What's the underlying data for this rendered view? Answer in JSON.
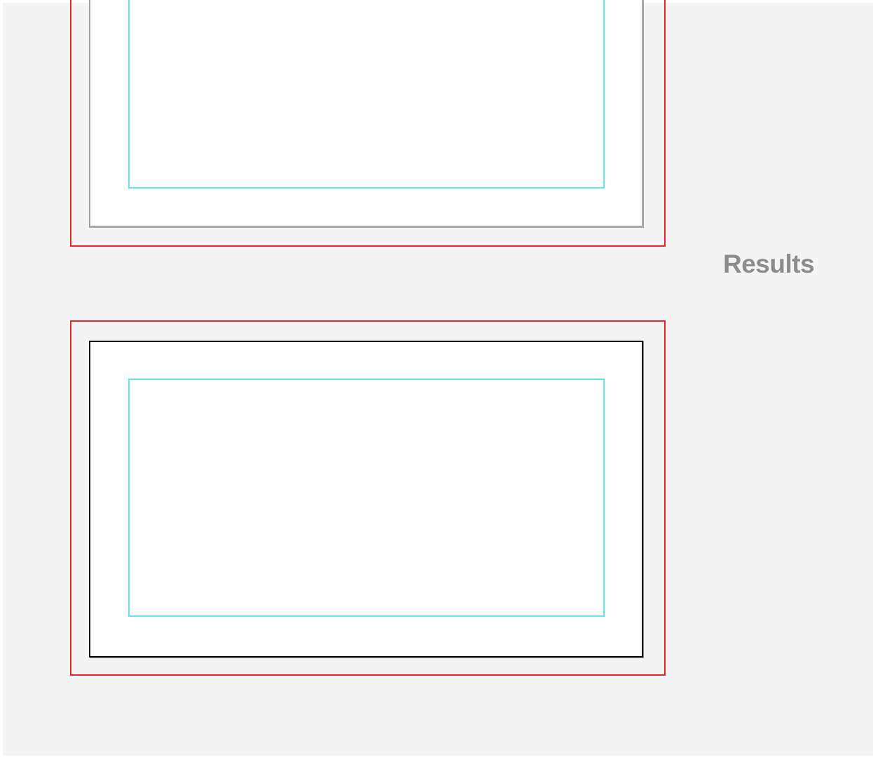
{
  "section_label": "Results",
  "colors": {
    "background": "#f4f4f4",
    "bleed_line": "#e8272b",
    "safe_line": "#5ee8ee",
    "trim_line_top": "#9d9d9d",
    "trim_line_bottom": "#111111",
    "label_text": "#8c8c8c"
  }
}
